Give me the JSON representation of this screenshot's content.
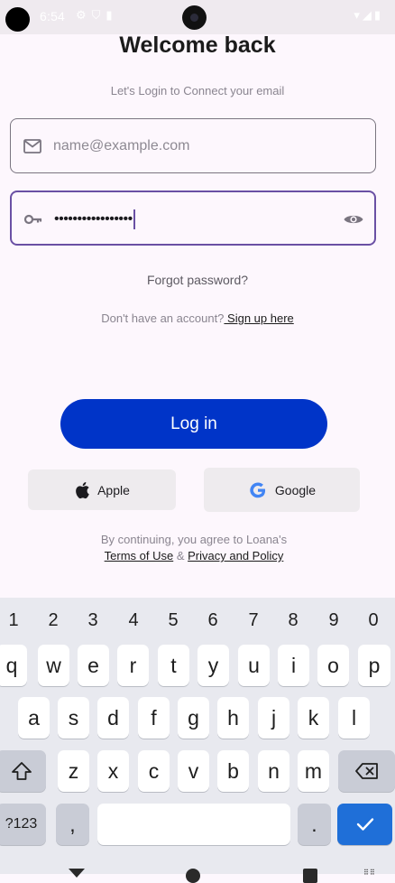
{
  "status_bar": {
    "time": "6:54"
  },
  "header": {
    "title": "Welcome back",
    "subtitle": "Let's Login to Connect your email"
  },
  "form": {
    "email_placeholder": "name@example.com",
    "email_value": "",
    "password_value": "•••••••••••••••••"
  },
  "links": {
    "forgot": "Forgot password?",
    "no_account": "Don't have an account?",
    "signup": " Sign up here"
  },
  "buttons": {
    "login": "Log in",
    "apple": "Apple",
    "google": "Google"
  },
  "terms": {
    "line1": "By continuing, you agree to Loana's",
    "terms_of_use": "Terms of Use",
    "amp": " & ",
    "privacy": "Privacy and Policy"
  },
  "keyboard": {
    "numbers": [
      "1",
      "2",
      "3",
      "4",
      "5",
      "6",
      "7",
      "8",
      "9",
      "0"
    ],
    "row1": [
      "q",
      "w",
      "e",
      "r",
      "t",
      "y",
      "u",
      "i",
      "o",
      "p"
    ],
    "row2": [
      "a",
      "s",
      "d",
      "f",
      "g",
      "h",
      "j",
      "k",
      "l"
    ],
    "row3": [
      "z",
      "x",
      "c",
      "v",
      "b",
      "n",
      "m"
    ],
    "symbols_key": "?123",
    "comma_key": ",",
    "period_key": "."
  },
  "colors": {
    "primary": "#0034c8",
    "focus_border": "#6a50a4",
    "background": "#fdf7fd",
    "enter_key": "#1f6fd8"
  }
}
